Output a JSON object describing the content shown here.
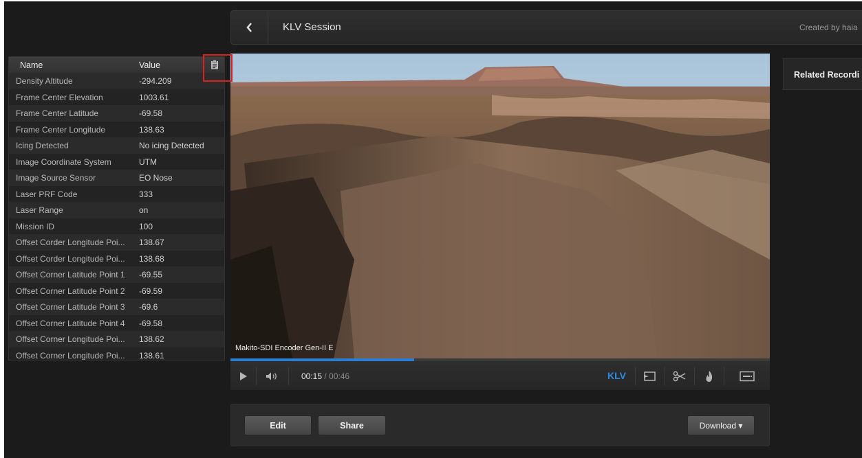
{
  "header": {
    "title": "KLV Session",
    "created_by": "Created by haia"
  },
  "klv_table": {
    "columns": {
      "name": "Name",
      "value": "Value"
    },
    "rows": [
      {
        "name": "Density Altitude",
        "value": "-294.209"
      },
      {
        "name": "Frame Center Elevation",
        "value": "1003.61"
      },
      {
        "name": "Frame Center Latitude",
        "value": "-69.58"
      },
      {
        "name": "Frame Center Longitude",
        "value": "138.63"
      },
      {
        "name": "Icing Detected",
        "value": "No icing Detected"
      },
      {
        "name": "Image Coordinate System",
        "value": "UTM"
      },
      {
        "name": "Image Source Sensor",
        "value": "EO Nose"
      },
      {
        "name": "Laser PRF Code",
        "value": "333"
      },
      {
        "name": "Laser Range",
        "value": "on"
      },
      {
        "name": "Mission ID",
        "value": "100"
      },
      {
        "name": "Offset Corder Longitude Poi...",
        "value": "138.67"
      },
      {
        "name": "Offset Corder Longitude Poi...",
        "value": "138.68"
      },
      {
        "name": "Offset Corner Latitude Point 1",
        "value": "-69.55"
      },
      {
        "name": "Offset Corner Latitude Point 2",
        "value": "-69.59"
      },
      {
        "name": "Offset Corner Latitude Point 3",
        "value": "-69.6"
      },
      {
        "name": "Offset Corner Latitude Point 4",
        "value": "-69.58"
      },
      {
        "name": "Offset Corner Longitude Poi...",
        "value": "138.62"
      },
      {
        "name": "Offset Corner Longitude Poi...",
        "value": "138.61"
      }
    ]
  },
  "video": {
    "caption": "Makito-SDI Encoder Gen-II E",
    "progress": 0.34
  },
  "player": {
    "current_time": "00:15",
    "total_time": " / 00:46",
    "klv_label": "KLV"
  },
  "actions": {
    "edit": "Edit",
    "share": "Share",
    "download": "Download ▾"
  },
  "related": {
    "title": "Related Recordi"
  },
  "icons": {
    "back": "chevron-left-icon",
    "copy": "clipboard-icon",
    "play": "play-icon",
    "volume": "volume-icon",
    "snapshot": "snapshot-icon",
    "clip": "scissors-icon",
    "burn": "flame-icon",
    "subtitles": "subtitle-icon"
  },
  "colors": {
    "accent": "#2a88e0",
    "highlight": "#e02020"
  }
}
